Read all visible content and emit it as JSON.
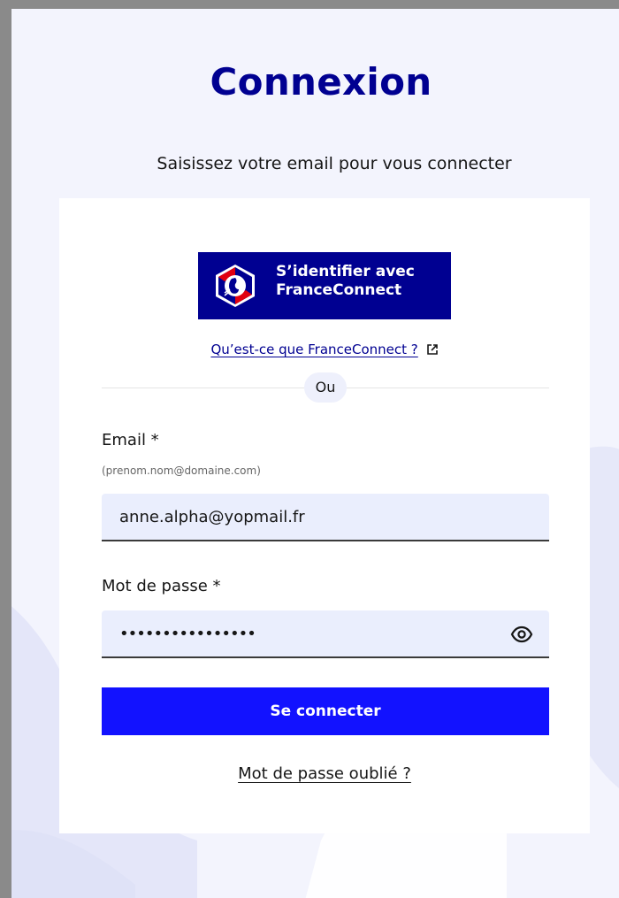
{
  "page": {
    "title": "Connexion",
    "subtitle": "Saisissez votre email pour vous connecter"
  },
  "franceconnect": {
    "button_line1": "S’identifier avec",
    "button_line2": "FranceConnect",
    "info_link": "Qu’est-ce que FranceConnect ?",
    "icon": "external-link-icon"
  },
  "separator": {
    "label": "Ou"
  },
  "email": {
    "label": "Email *",
    "hint": "(prenom.nom@domaine.com)",
    "value": "anne.alpha@yopmail.fr"
  },
  "password": {
    "label": "Mot de passe *",
    "value_masked": "••••••••••••••••",
    "toggle_icon": "eye-icon"
  },
  "actions": {
    "submit_label": "Se connecter",
    "forgot_label": "Mot de passe oublié ?"
  },
  "colors": {
    "primary": "#000091",
    "button": "#1212ff",
    "background": "#f3f4fd",
    "input_bg": "#eaeefd"
  }
}
